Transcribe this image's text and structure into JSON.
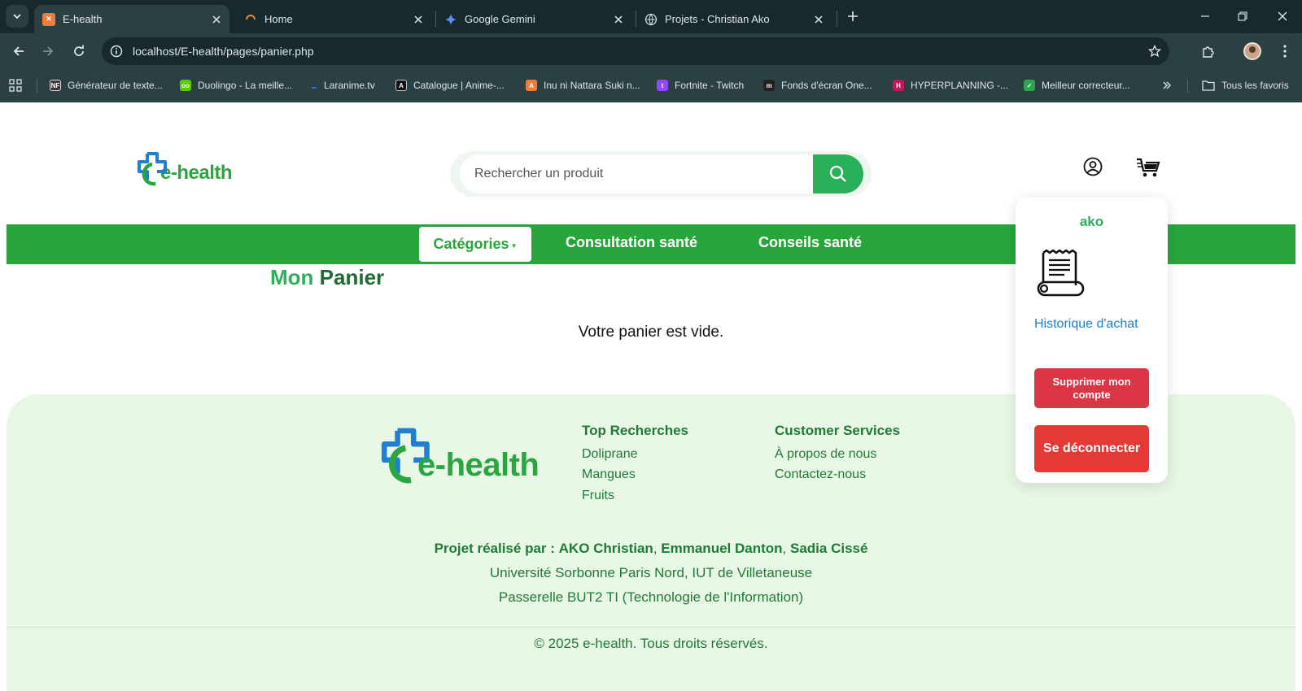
{
  "browser": {
    "tabs": [
      {
        "title": "E-health",
        "active": true
      },
      {
        "title": "Home",
        "active": false
      },
      {
        "title": "Google Gemini",
        "active": false
      },
      {
        "title": "Projets - Christian Ako",
        "active": false
      }
    ],
    "url": "localhost/E-health/pages/panier.php",
    "bookmarks": [
      {
        "label": "Générateur de texte..."
      },
      {
        "label": "Duolingo - La meille..."
      },
      {
        "label": "Laranime.tv"
      },
      {
        "label": "Catalogue | Anime-..."
      },
      {
        "label": "Inu ni Nattara Suki n..."
      },
      {
        "label": "Fortnite - Twitch"
      },
      {
        "label": "Fonds d'écran One..."
      },
      {
        "label": "HYPERPLANNING -..."
      },
      {
        "label": "Meilleur correcteur..."
      }
    ],
    "all_bookmarks": "Tous les favoris"
  },
  "header": {
    "logo_text": "e-health",
    "search_placeholder": "Rechercher un produit"
  },
  "nav": {
    "categories": "Catégories",
    "consultation": "Consultation santé",
    "conseils": "Conseils santé"
  },
  "main": {
    "title_part1": "Mon",
    "title_part2": "Panier",
    "empty_message": "Votre panier est vide."
  },
  "dropdown": {
    "username": "ako",
    "history": "Historique d'achat",
    "delete_account": "Supprimer mon compte",
    "logout": "Se déconnecter"
  },
  "footer": {
    "logo_text": "e-health",
    "top_title": "Top Recherches",
    "top_links": [
      "Doliprane",
      "Mangues",
      "Fruits"
    ],
    "services_title": "Customer Services",
    "services_links": [
      "À propos de nous",
      "Contactez-nous"
    ],
    "credits_prefix": "Projet réalisé par :",
    "author1": "AKO Christian",
    "author2": "Emmanuel Danton",
    "author3": "Sadia Cissé",
    "university": "Université Sorbonne Paris Nord, IUT de Villetaneuse",
    "program": "Passerelle BUT2 TI (Technologie de l'Information)",
    "copyright": "© 2025 e-health. Tous droits réservés."
  },
  "colors": {
    "brand_green": "#28a63c",
    "dark_green": "#1f7a35",
    "danger_red": "#dc3545",
    "link_blue": "#1f7fd1"
  }
}
